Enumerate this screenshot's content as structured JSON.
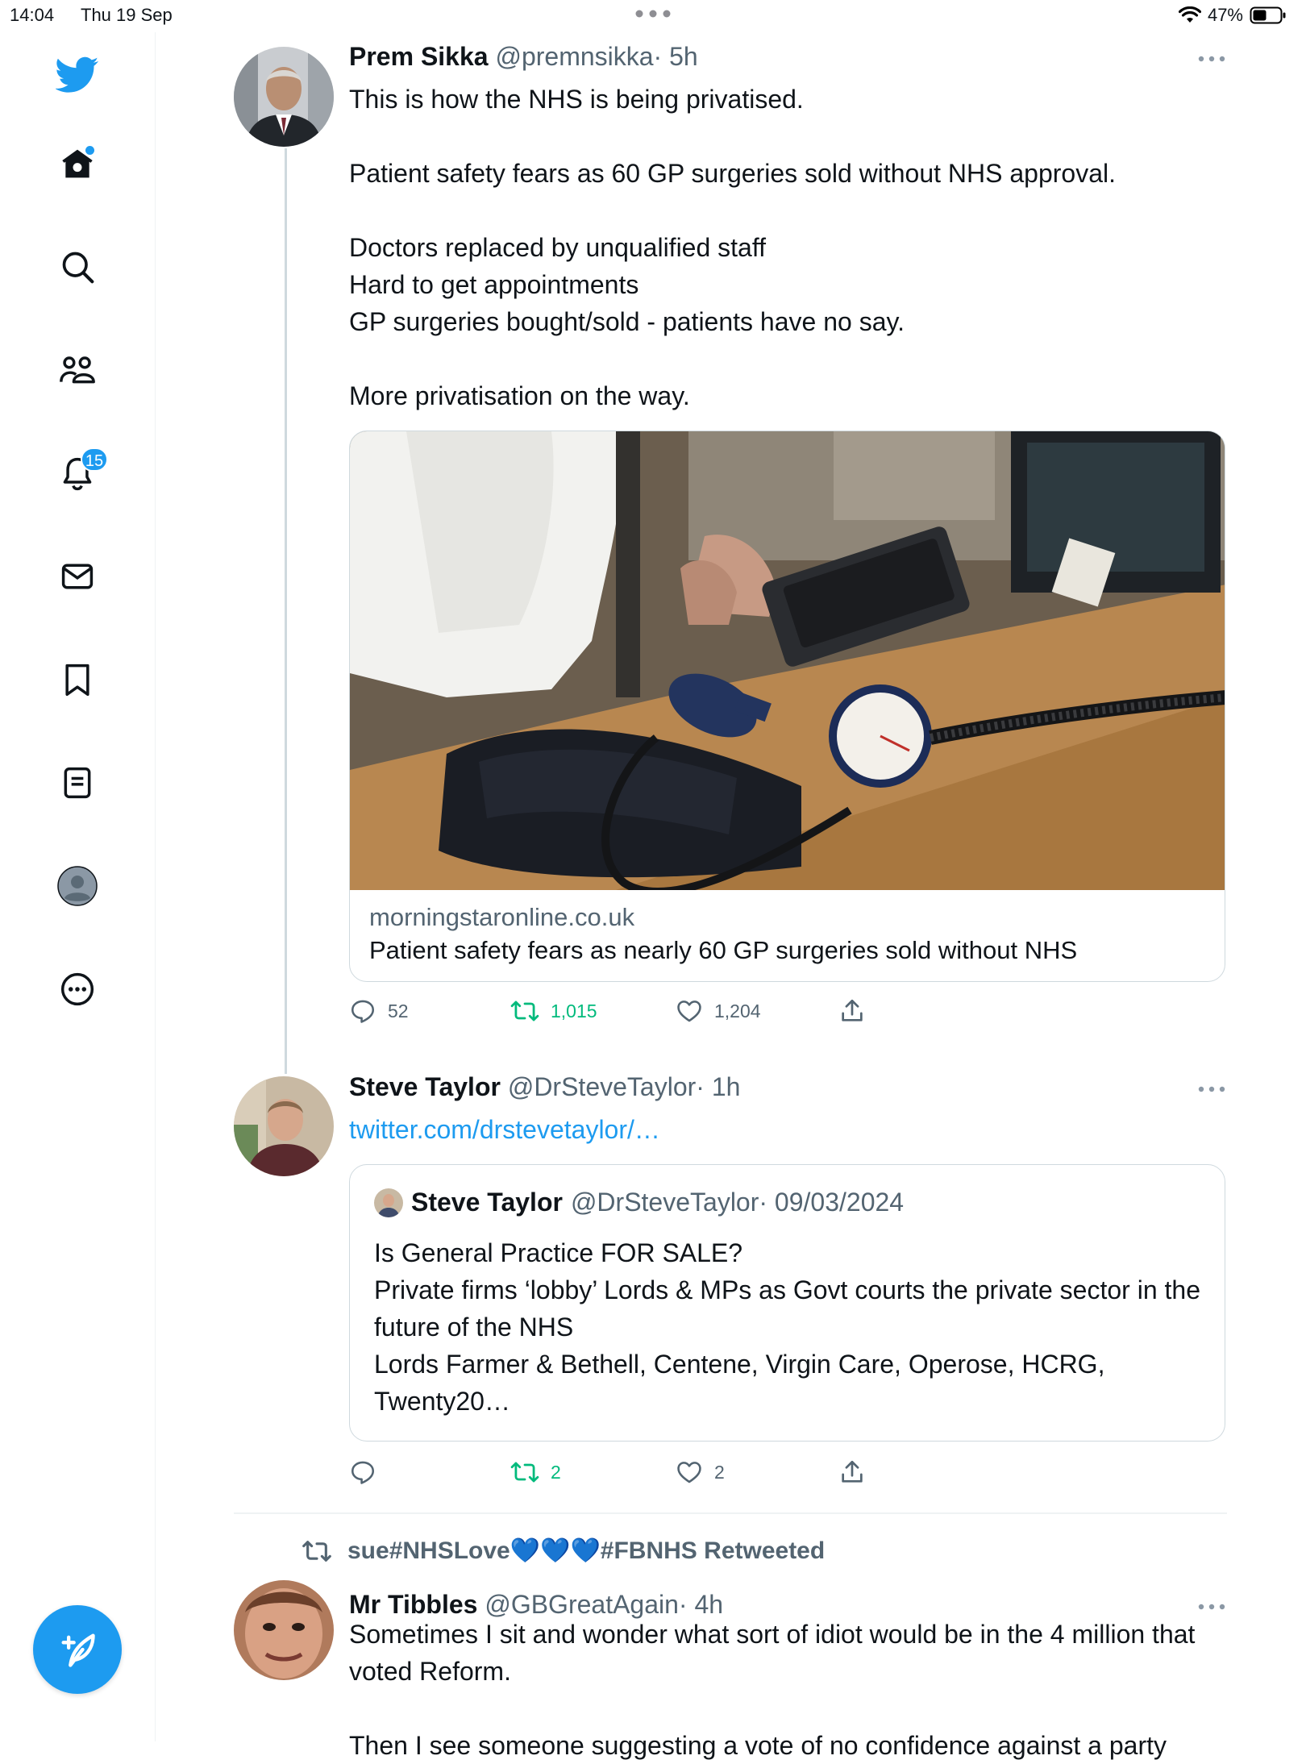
{
  "status_bar": {
    "time": "14:04",
    "date": "Thu 19 Sep",
    "battery": "47%"
  },
  "sidebar": {
    "items": [
      {
        "name": "home",
        "icon": "home-icon"
      },
      {
        "name": "search",
        "icon": "search-icon"
      },
      {
        "name": "communities",
        "icon": "communities-icon"
      },
      {
        "name": "notifications",
        "icon": "bell-icon",
        "badge": "15"
      },
      {
        "name": "messages",
        "icon": "mail-icon"
      },
      {
        "name": "bookmarks",
        "icon": "bookmark-icon"
      },
      {
        "name": "lists",
        "icon": "list-icon"
      },
      {
        "name": "profile",
        "icon": "profile-icon"
      },
      {
        "name": "more",
        "icon": "more-circle-icon"
      }
    ],
    "notifications_badge": "15",
    "compose_icon": "feather-plus-icon"
  },
  "tweets": [
    {
      "name": "Prem Sikka",
      "handle": "@premnsikka",
      "time": "· 5h",
      "text": "This is how the NHS is being privatised.\n\nPatient safety fears as 60 GP surgeries sold without NHS approval.\n\nDoctors replaced by unqualified staff\nHard to get appointments\nGP surgeries bought/sold - patients have no say.\n\nMore privatisation on the way.",
      "card": {
        "domain": "morningstaronline.co.uk",
        "title": "Patient safety fears as nearly 60 GP surgeries sold without NHS"
      },
      "replies": "52",
      "retweets": "1,015",
      "likes": "1,204"
    },
    {
      "name": "Steve Taylor",
      "handle": "@DrSteveTaylor",
      "time": "· 1h",
      "link": "twitter.com/drstevetaylor/…",
      "quote": {
        "name": "Steve Taylor",
        "handle": "@DrSteveTaylor",
        "date": "· 09/03/2024",
        "text": "Is General Practice FOR SALE?\nPrivate firms ‘lobby’ Lords & MPs as Govt courts the private sector in the future of the NHS\nLords Farmer & Bethell, Centene, Virgin Care, Operose, HCRG, Twenty20…"
      },
      "replies": "",
      "retweets": "2",
      "likes": "2"
    },
    {
      "retweeted_by": "sue#NHSLove💙💙💙#FBNHS Retweeted",
      "name": "Mr Tibbles",
      "handle": "@GBGreatAgain",
      "time": "· 4h",
      "text": "Sometimes I sit and wonder what sort of idiot would be in the 4 million that voted Reform.\n\nThen I see someone suggesting a vote of no confidence against a party"
    }
  ],
  "colors": {
    "accent": "#1d9bf0",
    "retweet": "#00ba7c",
    "secondary_text": "#536471",
    "border": "#cfd9de"
  }
}
